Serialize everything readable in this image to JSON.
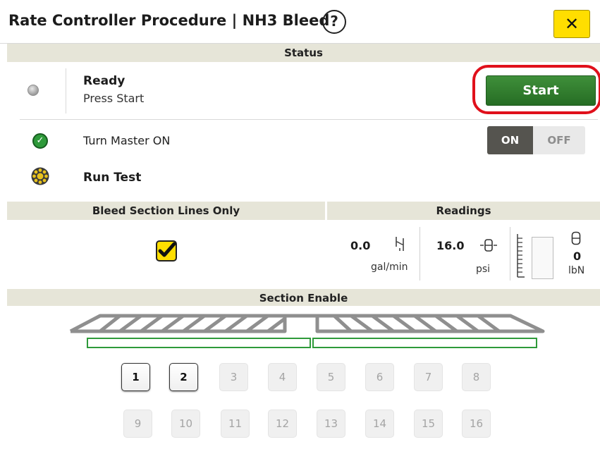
{
  "header": {
    "title": "Rate Controller Procedure | NH3 Bleed",
    "help_icon": "question-circle-icon",
    "close_label": "✕"
  },
  "status": {
    "section_title": "Status",
    "state": "Ready",
    "message": "Press Start",
    "start_label": "Start",
    "highlight_color": "#e0101b",
    "start_color": "#2f7d2c"
  },
  "master": {
    "label": "Turn Master ON",
    "on_label": "ON",
    "off_label": "OFF",
    "selected": "ON",
    "status_icon": "checkmark-circle-icon"
  },
  "run_test": {
    "label": "Run Test",
    "status_icon": "in-progress-icon"
  },
  "bleed": {
    "section_title": "Bleed Section Lines Only",
    "checked": true,
    "accent": "#ffde00"
  },
  "readings": {
    "section_title": "Readings",
    "flow_value": "0.0",
    "flow_unit": "gal/min",
    "flow_icon": "flow-icon",
    "pressure_value": "16.0",
    "pressure_unit": "psi",
    "pressure_icon": "pressure-gauge-icon",
    "tank_value": "0",
    "tank_unit": "lbN",
    "tank_icon": "tank-icon",
    "tank_level": 0
  },
  "sections": {
    "section_title": "Section Enable",
    "row1": [
      {
        "label": "1",
        "enabled": true
      },
      {
        "label": "2",
        "enabled": true
      },
      {
        "label": "3",
        "enabled": false
      },
      {
        "label": "4",
        "enabled": false
      },
      {
        "label": "5",
        "enabled": false
      },
      {
        "label": "6",
        "enabled": false
      },
      {
        "label": "7",
        "enabled": false
      },
      {
        "label": "8",
        "enabled": false
      }
    ],
    "row2": [
      {
        "label": "9",
        "enabled": false
      },
      {
        "label": "10",
        "enabled": false
      },
      {
        "label": "11",
        "enabled": false
      },
      {
        "label": "12",
        "enabled": false
      },
      {
        "label": "13",
        "enabled": false
      },
      {
        "label": "14",
        "enabled": false
      },
      {
        "label": "15",
        "enabled": false
      },
      {
        "label": "16",
        "enabled": false
      }
    ],
    "active_color": "#2e9a3a"
  }
}
